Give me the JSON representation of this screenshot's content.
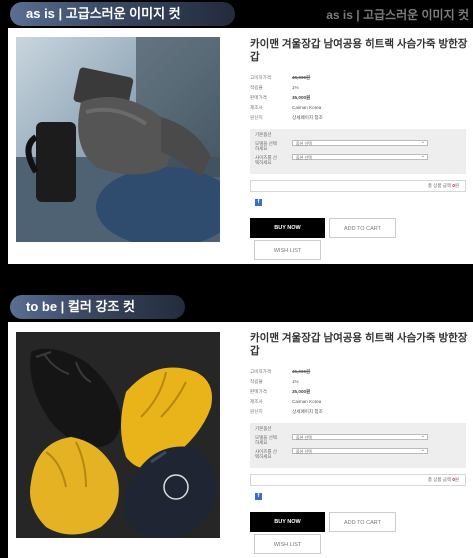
{
  "headers": {
    "before": "as is | 고급스러운 이미지 컷",
    "before_ghost": "as is | 고급스러운 이미지 컷",
    "after": "to be | 컬러 강조 컷"
  },
  "product": {
    "title": "카이맨 겨울장갑 남여공용 히트랙 사슴가죽 방한장갑",
    "info": [
      {
        "label": "고비자가격",
        "value": "45,000원",
        "style": "strike"
      },
      {
        "label": "적립율",
        "value": "1%",
        "style": "normal"
      },
      {
        "label": "판매가격",
        "value": "35,000원",
        "style": "price"
      },
      {
        "label": "제조사",
        "value": "Caiman Korea",
        "style": "normal"
      },
      {
        "label": "원산지",
        "value": "상세페이지 참조",
        "style": "normal"
      }
    ],
    "options_title": "기본옵션",
    "options": [
      {
        "label": "모델을 선택하세요",
        "value": "옵션 선택"
      },
      {
        "label": "사이즈를 선택하세요",
        "value": "옵션 선택"
      }
    ],
    "total_label": "총 상품 금액",
    "total_value": "0",
    "total_unit": "원",
    "buttons": {
      "buy": "BUY NOW",
      "cart": "ADD TO CART",
      "wish": "WISH LIST"
    },
    "share_icon": "facebook-icon"
  },
  "colors": {
    "pill_start": "#5a6f93",
    "pill_end": "#232b3c",
    "buy_bg": "#000000",
    "glove_yellow": "#e8b41a"
  }
}
